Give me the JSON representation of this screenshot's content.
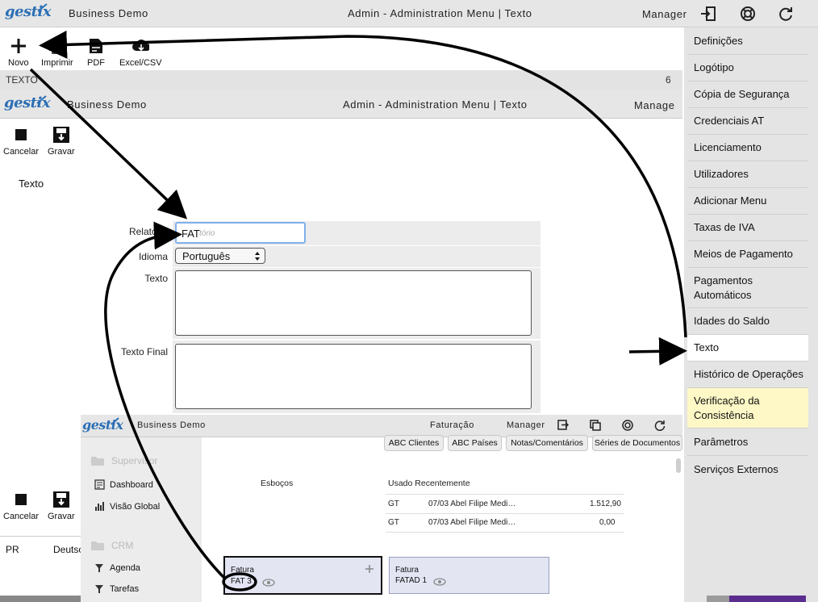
{
  "header": {
    "logo": "gestix",
    "company": "Business Demo",
    "title": "Admin - Administration Menu | Texto",
    "user": "Manager"
  },
  "toolbar": {
    "novo": "Novo",
    "imprimir": "Imprimir",
    "pdf": "PDF",
    "excel": "Excel/CSV",
    "strip_label": "TEXTO",
    "strip_count": "6"
  },
  "header2": {
    "logo": "gestix",
    "company": "Business Demo",
    "title": "Admin - Administration Menu | Texto",
    "user": "Manage"
  },
  "edit_toolbar": {
    "cancelar": "Cancelar",
    "gravar": "Gravar"
  },
  "section_title": "Texto",
  "form": {
    "relatorio_label": "Relatório",
    "relatorio_value": "FAT",
    "relatorio_placeholder": "Relatório",
    "idioma_label": "Idioma",
    "idioma_value": "Português",
    "texto_label": "Texto",
    "texto_final_label": "Texto Final"
  },
  "bottom_toolbar": {
    "cancelar": "Cancelar",
    "gravar": "Gravar"
  },
  "bottom_row": {
    "col1": "PR",
    "col2": "Deutsc"
  },
  "sidebar": {
    "items": [
      "Definições",
      "Logótipo",
      "Cópia de Segurança",
      "Credenciais AT",
      "Licenciamento",
      "Utilizadores",
      "Adicionar Menu",
      "Taxas de IVA",
      "Meios de Pagamento",
      "Pagamentos",
      "Automáticos",
      "Idades do Saldo",
      "Texto",
      "Histórico de Operações",
      "Verificação da",
      "Consistência",
      "Parâmetros",
      "Serviços Externos"
    ],
    "active_color": "#ffffff",
    "highlight_color": "#fdf8c6"
  },
  "shot3": {
    "logo": "gestix",
    "company": "Business Demo",
    "title": "Faturação",
    "user": "Manager",
    "nav": {
      "supervisor": "Supervisor",
      "dashboard": "Dashboard",
      "visao": "Visão Global",
      "crm": "CRM",
      "agenda": "Agenda",
      "tarefas": "Tarefas"
    },
    "tabs": [
      "ABC Clientes",
      "ABC Países",
      "Notas/Comentários",
      "Séries de Documentos"
    ],
    "esbocos": "Esboços",
    "recent_title": "Usado Recentemente",
    "recent_rows": [
      {
        "type": "GT",
        "desc": "07/03 Abel Filipe Medi…",
        "amount": "1.512,90"
      },
      {
        "type": "GT",
        "desc": "07/03 Abel Filipe Medi…",
        "amount": "0,00"
      }
    ],
    "card1": {
      "title": "Fatura",
      "code": "FAT 3"
    },
    "card2": {
      "title": "Fatura",
      "code": "FATAD 1"
    }
  },
  "colors": {
    "logo_blue": "#2c6fb5",
    "header_bg": "#e6e6e6",
    "input_focus": "#7fb0ea",
    "card_bg": "#e3e5f3"
  }
}
